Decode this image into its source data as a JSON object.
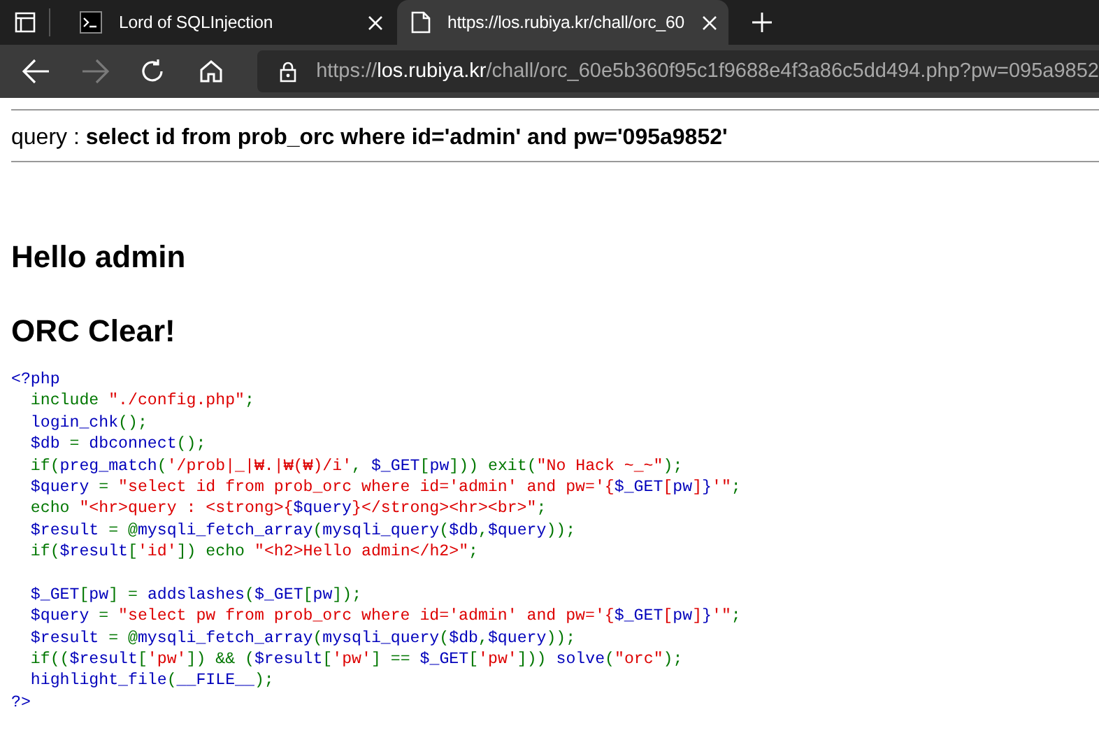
{
  "browser": {
    "tabs": [
      {
        "title": "Lord of SQLInjection",
        "kind": "terminal",
        "selected": false
      },
      {
        "title": "https://los.rubiya.kr/chall/orc_60",
        "kind": "page",
        "selected": true
      }
    ],
    "nav": [
      {
        "kind": "back",
        "disabled": false
      },
      {
        "kind": "forward",
        "disabled": true
      },
      {
        "kind": "reload",
        "disabled": false
      },
      {
        "kind": "home",
        "disabled": false
      }
    ],
    "address": {
      "scheme": "https://",
      "host": "los.rubiya.kr",
      "path": "/chall/orc_60e5b360f95c1f9688e4f3a86c5dd494.php?pw=095a9852"
    }
  },
  "page": {
    "query_label": "query : ",
    "query": "select id from prob_orc where id='admin' and pw='095a9852'",
    "headings": [
      "Hello admin",
      "ORC Clear!"
    ],
    "code_lines": [
      {
        "segments": [
          {
            "kind": "default",
            "text": "<?php"
          }
        ]
      },
      {
        "segments": [
          {
            "kind": "keyword",
            "text": "  include "
          },
          {
            "kind": "string",
            "text": "\"./config.php\""
          },
          {
            "kind": "keyword",
            "text": ";"
          }
        ]
      },
      {
        "segments": [
          {
            "kind": "default",
            "text": "  login_chk"
          },
          {
            "kind": "keyword",
            "text": "();"
          }
        ]
      },
      {
        "segments": [
          {
            "kind": "default",
            "text": "  $db "
          },
          {
            "kind": "keyword",
            "text": "= "
          },
          {
            "kind": "default",
            "text": "dbconnect"
          },
          {
            "kind": "keyword",
            "text": "();"
          }
        ]
      },
      {
        "segments": [
          {
            "kind": "keyword",
            "text": "  if("
          },
          {
            "kind": "default",
            "text": "preg_match"
          },
          {
            "kind": "keyword",
            "text": "("
          },
          {
            "kind": "string",
            "text": "'/prob|_|₩.|₩(₩)/i'"
          },
          {
            "kind": "keyword",
            "text": ", "
          },
          {
            "kind": "default",
            "text": "$_GET"
          },
          {
            "kind": "keyword",
            "text": "["
          },
          {
            "kind": "default",
            "text": "pw"
          },
          {
            "kind": "keyword",
            "text": "])) exit("
          },
          {
            "kind": "string",
            "text": "\"No Hack ~_~\""
          },
          {
            "kind": "keyword",
            "text": ");"
          }
        ]
      },
      {
        "segments": [
          {
            "kind": "default",
            "text": "  $query "
          },
          {
            "kind": "keyword",
            "text": "= "
          },
          {
            "kind": "string",
            "text": "\"select id from prob_orc where id='admin' and pw='{"
          },
          {
            "kind": "default",
            "text": "$_GET"
          },
          {
            "kind": "string",
            "text": "["
          },
          {
            "kind": "default",
            "text": "pw"
          },
          {
            "kind": "string",
            "text": "]"
          },
          {
            "kind": "default",
            "text": "}"
          },
          {
            "kind": "string",
            "text": "'\""
          },
          {
            "kind": "keyword",
            "text": ";"
          }
        ]
      },
      {
        "segments": [
          {
            "kind": "keyword",
            "text": "  echo "
          },
          {
            "kind": "string",
            "text": "\"<hr>query : <strong>{"
          },
          {
            "kind": "default",
            "text": "$query"
          },
          {
            "kind": "string",
            "text": "}</strong><hr><br>\""
          },
          {
            "kind": "keyword",
            "text": ";"
          }
        ]
      },
      {
        "segments": [
          {
            "kind": "default",
            "text": "  $result "
          },
          {
            "kind": "keyword",
            "text": "= @"
          },
          {
            "kind": "default",
            "text": "mysqli_fetch_array"
          },
          {
            "kind": "keyword",
            "text": "("
          },
          {
            "kind": "default",
            "text": "mysqli_query"
          },
          {
            "kind": "keyword",
            "text": "("
          },
          {
            "kind": "default",
            "text": "$db"
          },
          {
            "kind": "keyword",
            "text": ","
          },
          {
            "kind": "default",
            "text": "$query"
          },
          {
            "kind": "keyword",
            "text": "));"
          }
        ]
      },
      {
        "segments": [
          {
            "kind": "keyword",
            "text": "  if("
          },
          {
            "kind": "default",
            "text": "$result"
          },
          {
            "kind": "keyword",
            "text": "["
          },
          {
            "kind": "string",
            "text": "'id'"
          },
          {
            "kind": "keyword",
            "text": "]) echo "
          },
          {
            "kind": "string",
            "text": "\"<h2>Hello admin</h2>\""
          },
          {
            "kind": "keyword",
            "text": ";"
          }
        ]
      },
      {
        "kind": "blank"
      },
      {
        "segments": [
          {
            "kind": "default",
            "text": "  $_GET"
          },
          {
            "kind": "keyword",
            "text": "["
          },
          {
            "kind": "default",
            "text": "pw"
          },
          {
            "kind": "keyword",
            "text": "] = "
          },
          {
            "kind": "default",
            "text": "addslashes"
          },
          {
            "kind": "keyword",
            "text": "("
          },
          {
            "kind": "default",
            "text": "$_GET"
          },
          {
            "kind": "keyword",
            "text": "["
          },
          {
            "kind": "default",
            "text": "pw"
          },
          {
            "kind": "keyword",
            "text": "]);"
          }
        ]
      },
      {
        "segments": [
          {
            "kind": "default",
            "text": "  $query "
          },
          {
            "kind": "keyword",
            "text": "= "
          },
          {
            "kind": "string",
            "text": "\"select pw from prob_orc where id='admin' and pw='{"
          },
          {
            "kind": "default",
            "text": "$_GET"
          },
          {
            "kind": "string",
            "text": "["
          },
          {
            "kind": "default",
            "text": "pw"
          },
          {
            "kind": "string",
            "text": "]"
          },
          {
            "kind": "default",
            "text": "}"
          },
          {
            "kind": "string",
            "text": "'\""
          },
          {
            "kind": "keyword",
            "text": ";"
          }
        ]
      },
      {
        "segments": [
          {
            "kind": "default",
            "text": "  $result "
          },
          {
            "kind": "keyword",
            "text": "= @"
          },
          {
            "kind": "default",
            "text": "mysqli_fetch_array"
          },
          {
            "kind": "keyword",
            "text": "("
          },
          {
            "kind": "default",
            "text": "mysqli_query"
          },
          {
            "kind": "keyword",
            "text": "("
          },
          {
            "kind": "default",
            "text": "$db"
          },
          {
            "kind": "keyword",
            "text": ","
          },
          {
            "kind": "default",
            "text": "$query"
          },
          {
            "kind": "keyword",
            "text": "));"
          }
        ]
      },
      {
        "segments": [
          {
            "kind": "keyword",
            "text": "  if(("
          },
          {
            "kind": "default",
            "text": "$result"
          },
          {
            "kind": "keyword",
            "text": "["
          },
          {
            "kind": "string",
            "text": "'pw'"
          },
          {
            "kind": "keyword",
            "text": "]) && ("
          },
          {
            "kind": "default",
            "text": "$result"
          },
          {
            "kind": "keyword",
            "text": "["
          },
          {
            "kind": "string",
            "text": "'pw'"
          },
          {
            "kind": "keyword",
            "text": "] == "
          },
          {
            "kind": "default",
            "text": "$_GET"
          },
          {
            "kind": "keyword",
            "text": "["
          },
          {
            "kind": "string",
            "text": "'pw'"
          },
          {
            "kind": "keyword",
            "text": "])) "
          },
          {
            "kind": "default",
            "text": "solve"
          },
          {
            "kind": "keyword",
            "text": "("
          },
          {
            "kind": "string",
            "text": "\"orc\""
          },
          {
            "kind": "keyword",
            "text": ");"
          }
        ]
      },
      {
        "segments": [
          {
            "kind": "default",
            "text": "  highlight_file"
          },
          {
            "kind": "keyword",
            "text": "("
          },
          {
            "kind": "default",
            "text": "__FILE__"
          },
          {
            "kind": "keyword",
            "text": ");"
          }
        ]
      },
      {
        "segments": [
          {
            "kind": "default",
            "text": "?>"
          }
        ]
      }
    ]
  }
}
